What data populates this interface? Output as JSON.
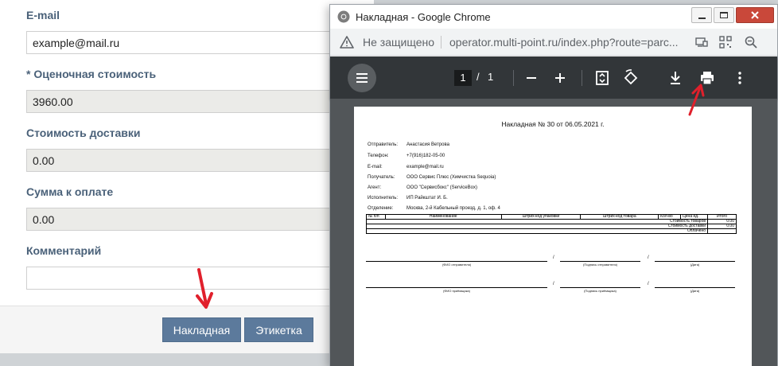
{
  "form": {
    "email_label": "E-mail",
    "email_value": "example@mail.ru",
    "estimate_label": "* Оценочная стоимость",
    "estimate_value": "3960.00",
    "delivery_label": "Стоимость доставки",
    "delivery_value": "0.00",
    "total_label": "Сумма к оплате",
    "total_value": "0.00",
    "comment_label": "Комментарий",
    "comment_value": "",
    "waybill_button": "Накладная",
    "label_button": "Этикетка"
  },
  "chrome": {
    "title": "Накладная - Google Chrome",
    "security": "Не защищено",
    "url": "operator.multi-point.ru/index.php?route=parc..."
  },
  "pdf": {
    "page_current": "1",
    "page_sep": "/",
    "page_total": "1",
    "doc_title": "Накладная № 30 от 06.05.2021 г.",
    "fields": [
      {
        "label": "Отправитель:",
        "value": "Анастасия  Ветрова"
      },
      {
        "label": "Телефон:",
        "value": "+7(916)182-05-00"
      },
      {
        "label": "E-mail:",
        "value": "example@mail.ru"
      },
      {
        "label": "Получатель:",
        "value": "ООО Сервис Плюс (Химчистка Sequoia)"
      },
      {
        "label": "Агент:",
        "value": "ООО \"Сервисбокс\" (ServiceBox)"
      },
      {
        "label": "Исполнитель:",
        "value": "ИП Райкштат И. Б."
      },
      {
        "label": "Отделение:",
        "value": "Москва, 2-й Кабельный проезд, д. 1, оф. 4"
      }
    ],
    "table_headers": [
      "№ п/п",
      "Наименование",
      "Штрих-код упаковки",
      "Штрих-код товара",
      "Кол-во",
      "Цена ед.",
      "Итого"
    ],
    "summary_rows": [
      {
        "label": "Стоимость товаров",
        "value": "0.00"
      },
      {
        "label": "Стоимость доставки",
        "value": "0.00"
      },
      {
        "label": "Оплачено",
        "value": ""
      }
    ],
    "sig_slash": "/",
    "sig_row1": [
      "(ФИО отправителя)",
      "(Подпись отправителя)",
      "(Дата)"
    ],
    "sig_row2": [
      "(ФИО приёмщика)",
      "(Подпись приёмщика)",
      "(Дата)"
    ]
  },
  "colors": {
    "accent_button": "#5c7a9c",
    "label_text": "#4a6179",
    "annotation_arrow": "#e0202c",
    "pdf_toolbar": "#323639"
  }
}
